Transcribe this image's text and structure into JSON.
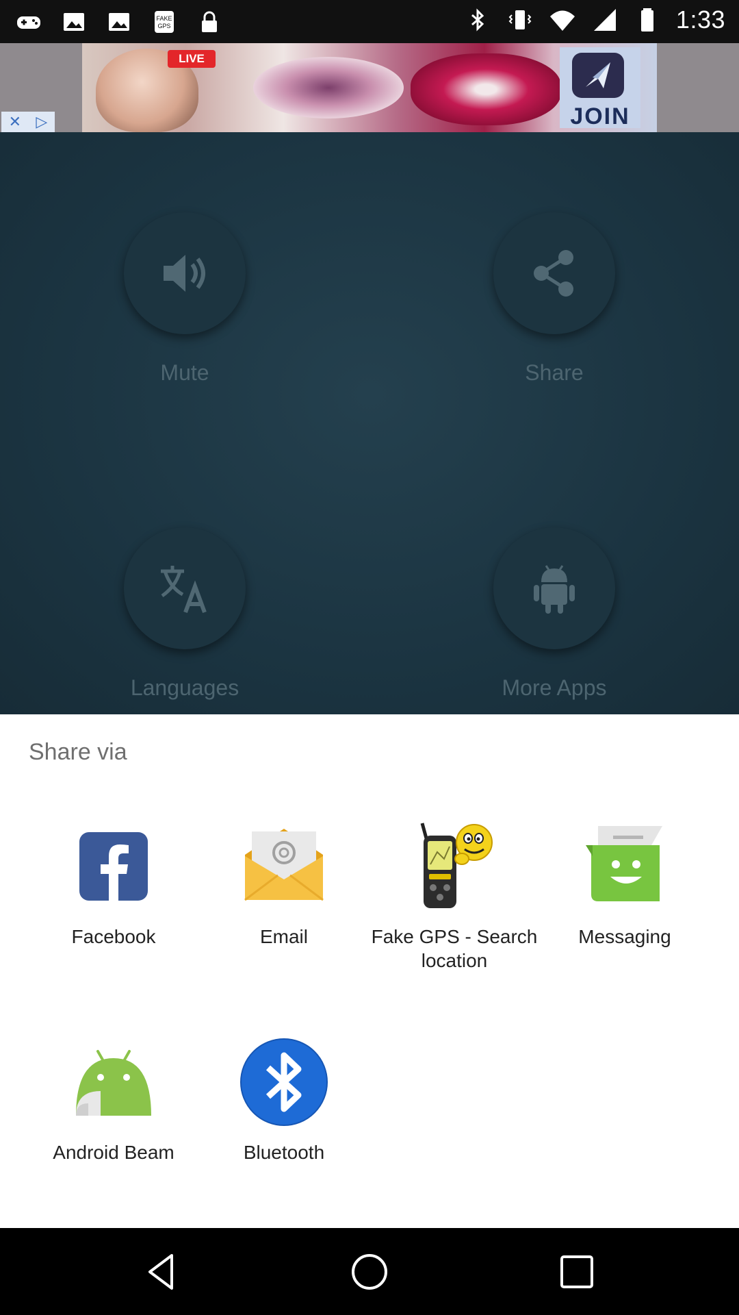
{
  "status_bar": {
    "time": "1:33",
    "left_icons": [
      "gamepad-icon",
      "image-icon",
      "image-icon",
      "fake-gps-icon",
      "lock-icon"
    ],
    "right_icons": [
      "bluetooth-icon",
      "vibrate-icon",
      "wifi-icon",
      "signal-icon",
      "battery-icon"
    ]
  },
  "ad": {
    "live_badge": "LIVE",
    "join_text": "JOIN",
    "close_icons": [
      "close-icon",
      "adchoices-icon"
    ]
  },
  "app_tiles": [
    {
      "label": "Mute",
      "icon": "speaker-icon"
    },
    {
      "label": "Share",
      "icon": "share-icon"
    },
    {
      "label": "Languages",
      "icon": "translate-icon"
    },
    {
      "label": "More Apps",
      "icon": "android-icon"
    }
  ],
  "share_sheet": {
    "title": "Share via",
    "items": [
      {
        "label": "Facebook",
        "icon": "facebook-icon"
      },
      {
        "label": "Email",
        "icon": "email-icon"
      },
      {
        "label": "Fake GPS - Search location",
        "icon": "fake-gps-icon"
      },
      {
        "label": "Messaging",
        "icon": "messaging-icon"
      },
      {
        "label": "Android Beam",
        "icon": "android-beam-icon"
      },
      {
        "label": "Bluetooth",
        "icon": "bluetooth-icon"
      }
    ]
  },
  "colors": {
    "facebook": "#3b5998",
    "email": "#f4c242",
    "messaging": "#7cc846",
    "bluetooth": "#1e6bd6",
    "android_beam": "#8bc34a",
    "overlay": "#1f3a47"
  }
}
